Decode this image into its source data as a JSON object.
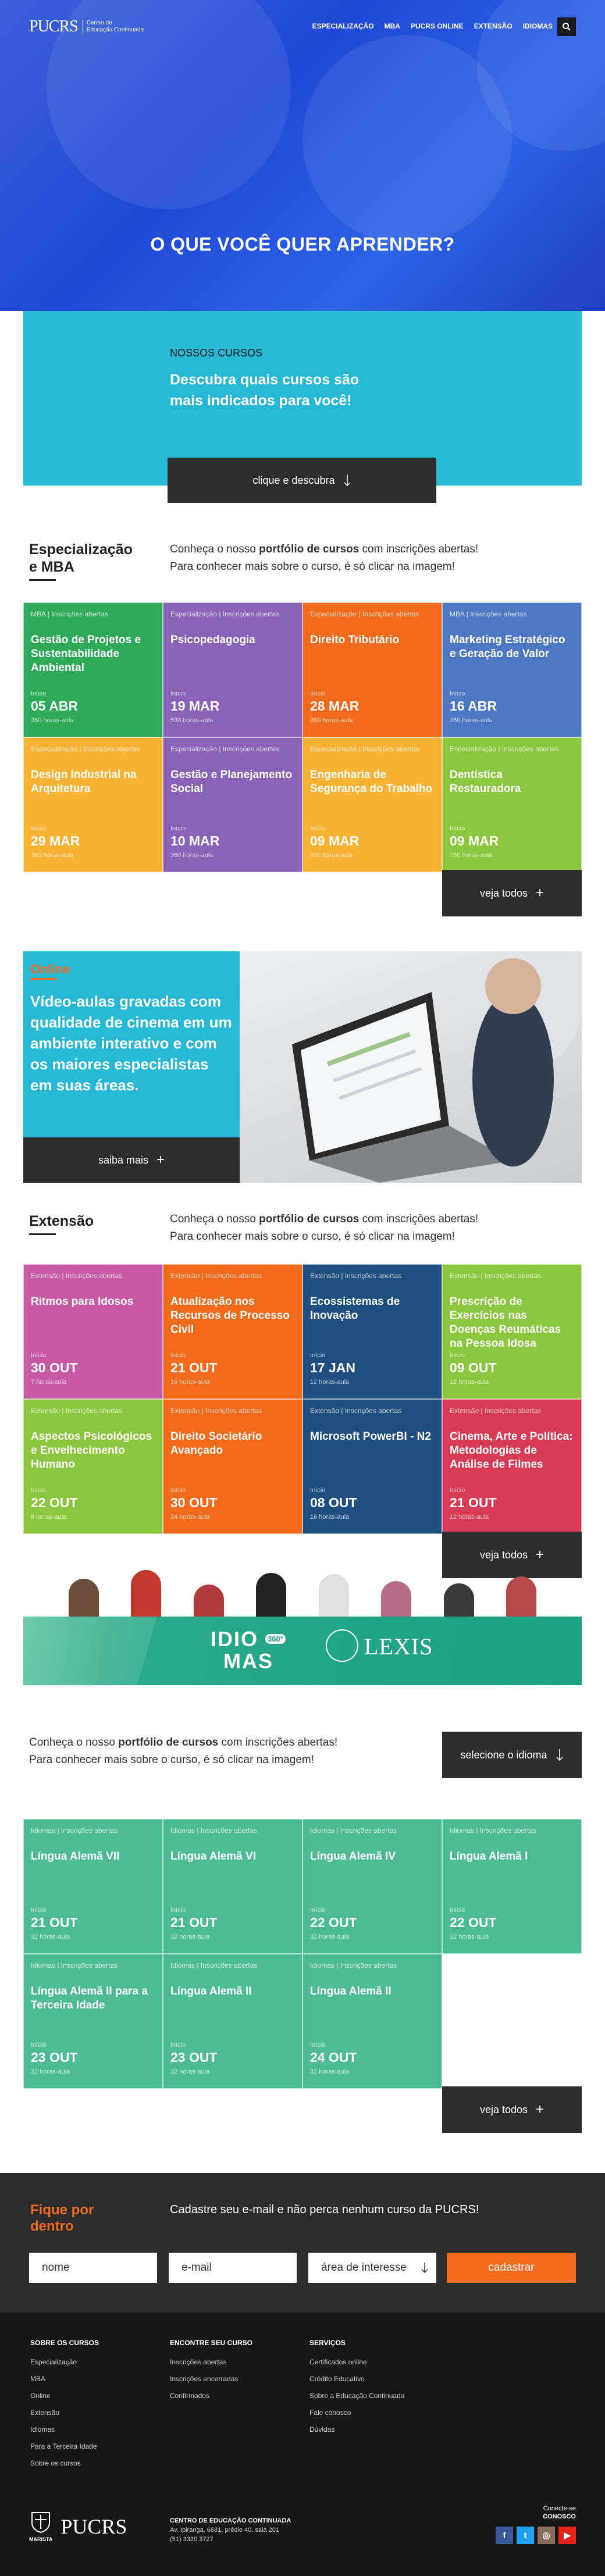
{
  "header": {
    "logo_brand": "PUCRS",
    "logo_sub_1": "Centro de",
    "logo_sub_2": "Educação Continuada",
    "nav": [
      "ESPECIALIZAÇÃO",
      "MBA",
      "PUCRS ONLINE",
      "EXTENSÃO",
      "IDIOMAS"
    ],
    "search_icon": "search-icon"
  },
  "hero": {
    "title": "O QUE VOCÊ QUER APRENDER?"
  },
  "cursos": {
    "eyebrow": "NOSSOS CURSOS",
    "lead": "Descubra quais cursos são mais indicados para você!",
    "button": "clique e descubra"
  },
  "especializacao": {
    "title_1": "Especialização",
    "title_2": "e MBA",
    "text_pre": "Conheça o nosso ",
    "text_bold": "portfólio de cursos",
    "text_post": " com inscrições abertas!",
    "text_2": "Para conhecer mais sobre o curso, é só clicar na imagem!",
    "cards": [
      {
        "tag": "MBA | Inscrições abertas",
        "title": "Gestão de Projetos e Sustentabilidade Ambiental",
        "ini": "Início",
        "date": "05 ABR",
        "hours": "360 horas-aula",
        "color": "#2faa5a"
      },
      {
        "tag": "Especialização | Inscrições abertas",
        "title": "Psicopedagogia",
        "ini": "Início",
        "date": "19 MAR",
        "hours": "530 horas-aula",
        "color": "#8a63b8"
      },
      {
        "tag": "Especialização | Inscrições abertas",
        "title": "Direito Tributário",
        "ini": "Início",
        "date": "28 MAR",
        "hours": "360 horas-aula",
        "color": "#f26a1b"
      },
      {
        "tag": "MBA | Inscrições abertas",
        "title": "Marketing Estratégico e Geração de Valor",
        "ini": "Início",
        "date": "16 ABR",
        "hours": "360 horas-aula",
        "color": "#4c78c4"
      },
      {
        "tag": "Especialização | Inscrições abertas",
        "title": "Design Industrial na Arquitetura",
        "ini": "Início",
        "date": "29 MAR",
        "hours": "360 horas-aula",
        "color": "#f9b233"
      },
      {
        "tag": "Especialização | Inscrições abertas",
        "title": "Gestão e Planejamento Social",
        "ini": "Início",
        "date": "10 MAR",
        "hours": "360 horas-aula",
        "color": "#8a63b8"
      },
      {
        "tag": "Especialização | Inscrições abertas",
        "title": "Engenharia de Segurança do Trabalho",
        "ini": "Início",
        "date": "09 MAR",
        "hours": "600 horas-aula",
        "color": "#f9b233"
      },
      {
        "tag": "Especialização | Inscrições abertas",
        "title": "Dentística Restauradora",
        "ini": "Início",
        "date": "09 MAR",
        "hours": "750 horas-aula",
        "color": "#8cc63e"
      }
    ],
    "veja": "veja todos"
  },
  "online": {
    "title": "Online",
    "desc": "Vídeo-aulas gravadas com qualidade de cinema em um ambiente interativo e com os maiores especialistas em suas áreas.",
    "button": "saiba mais"
  },
  "extensao": {
    "title": "Extensão",
    "text_pre": "Conheça o nosso ",
    "text_bold": "portfólio de cursos",
    "text_post": " com inscrições abertas!",
    "text_2": "Para conhecer mais sobre o curso, é só clicar na imagem!",
    "cards": [
      {
        "tag": "Extensão | Inscrições abertas",
        "title": "Ritmos para Idosos",
        "ini": "Início",
        "date": "30 OUT",
        "hours": "7 horas-aula",
        "color": "#c75aa5"
      },
      {
        "tag": "Extensão | Inscrições abertas",
        "title": "Atualização nos Recursos de Processo Civil",
        "ini": "Início",
        "date": "21 OUT",
        "hours": "16 horas-aula",
        "color": "#f26a1b"
      },
      {
        "tag": "Extensão | Inscrições abertas",
        "title": "Ecossistemas de Inovação",
        "ini": "Início",
        "date": "17 JAN",
        "hours": "12 horas-aula",
        "color": "#1f4e80"
      },
      {
        "tag": "Extensão | Inscrições abertas",
        "title": "Prescrição de Exercícios nas Doenças Reumáticas na Pessoa Idosa",
        "ini": "Início",
        "date": "09 OUT",
        "hours": "12 horas-aula",
        "color": "#8cc63e"
      },
      {
        "tag": "Extensão | Inscrições abertas",
        "title": "Aspectos Psicológicos e Envelhecimento Humano",
        "ini": "Início",
        "date": "22 OUT",
        "hours": "8 horas-aula",
        "color": "#8cc63e"
      },
      {
        "tag": "Extensão | Inscrições abertas",
        "title": "Direito Societário Avançado",
        "ini": "Início",
        "date": "30 OUT",
        "hours": "24 horas-aula",
        "color": "#f26a1b"
      },
      {
        "tag": "Extensão | Inscrições abertas",
        "title": "Microsoft PowerBI - N2",
        "ini": "Início",
        "date": "08 OUT",
        "hours": "16 horas-aula",
        "color": "#1f4e80"
      },
      {
        "tag": "Extensão | Inscrições abertas",
        "title": "Cinema, Arte e Política: Metodologias de Análise de Filmes",
        "ini": "Início",
        "date": "21 OUT",
        "hours": "12 horas-aula",
        "color": "#d93a55"
      }
    ],
    "veja": "veja todos"
  },
  "idiomas": {
    "logo_1": "IDIO",
    "logo_2": "MAS",
    "logo_badge": "360°",
    "lexis": "LEXIS",
    "text_pre": "Conheça o nosso ",
    "text_bold": "portfólio de cursos",
    "text_post": " com inscrições abertas!",
    "text_2": "Para conhecer mais sobre o curso, é só clicar na imagem!",
    "button": "selecione o idioma",
    "cards": [
      {
        "tag": "Idiomas | Inscrições abertas",
        "title": "Língua Alemã VII",
        "ini": "Início",
        "date": "21 OUT",
        "hours": "32 horas-aula",
        "color": "#4dbb93"
      },
      {
        "tag": "Idiomas | Inscrições abertas",
        "title": "Língua Alemã VI",
        "ini": "Início",
        "date": "21 OUT",
        "hours": "32 horas-aula",
        "color": "#4dbb93"
      },
      {
        "tag": "Idiomas | Inscrições abertas",
        "title": "Língua Alemã IV",
        "ini": "Início",
        "date": "22 OUT",
        "hours": "32 horas-aula",
        "color": "#4dbb93"
      },
      {
        "tag": "Idiomas | Inscrições abertas",
        "title": "Língua Alemã I",
        "ini": "Início",
        "date": "22 OUT",
        "hours": "32 horas-aula",
        "color": "#4dbb93"
      },
      {
        "tag": "Idiomas | Inscrições abertas",
        "title": "Língua Alemã II para a Terceira Idade",
        "ini": "Início",
        "date": "23 OUT",
        "hours": "32 horas-aula",
        "color": "#4dbb93"
      },
      {
        "tag": "Idiomas | Inscrições abertas",
        "title": "Língua Alemã II",
        "ini": "Início",
        "date": "23 OUT",
        "hours": "32 horas-aula",
        "color": "#4dbb93"
      },
      {
        "tag": "Idiomas | Inscrições abertas",
        "title": "Língua Alemã II",
        "ini": "Início",
        "date": "24 OUT",
        "hours": "32 horas-aula",
        "color": "#4dbb93"
      }
    ],
    "veja": "veja todos"
  },
  "newsletter": {
    "title_1": "Fique por",
    "title_2": "dentro",
    "lead": "Cadastre seu e-mail e não perca nenhum curso da PUCRS!",
    "name_placeholder": "nome",
    "email_placeholder": "e-mail",
    "interest": "área de interesse",
    "submit": "cadastrar"
  },
  "footer": {
    "col1_title": "SOBRE OS CURSOS",
    "col1": [
      "Especialização",
      "MBA",
      "Online",
      "Extensão",
      "Idiomas",
      "Para a Terceira Idade",
      "Sobre os cursos"
    ],
    "col2_title": "ENCONTRE SEU CURSO",
    "col2": [
      "Inscrições abertas",
      "Inscrições encerradas",
      "Confirmados"
    ],
    "col3_title": "SERVIÇOS",
    "col3": [
      "Certificados online",
      "Crédito Educativo",
      "Sobre a Educação Continuada",
      "Fale conosco",
      "Dúvidas"
    ],
    "marista": "MARISTA",
    "brand": "PUCRS",
    "addr_title": "CENTRO DE EDUCAÇÃO CONTINUADA",
    "addr_1": "Av. Ipiranga, 6681, prédio 40, sala 201",
    "addr_2": "(51) 3320 3727",
    "connect_1": "Conecte-se",
    "connect_2": "CONOSCO",
    "social": [
      "f",
      "t",
      "◎",
      "▶"
    ],
    "social_colors": [
      "#3b5998",
      "#1da1f2",
      "#8a6d5a",
      "#e62117"
    ]
  },
  "colors": {
    "hero_blue": "#2356e0",
    "cyan": "#27b8d6",
    "orange": "#f26a1b",
    "dark": "#2d2d2d"
  }
}
